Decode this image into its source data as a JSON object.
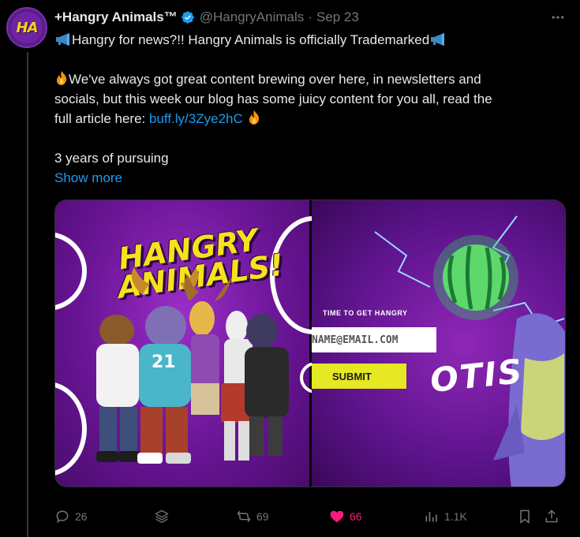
{
  "tweet": {
    "display_name": "+Hangry Animals™",
    "handle": "@HangryAnimals",
    "separator": "·",
    "date": "Sep 23",
    "avatar_text": "HA",
    "lines": {
      "line1": "Hangry for news?!! Hangry Animals is officially Trademarked",
      "line2": "We've always got great content brewing over here, in newsletters and",
      "line3": "socials, but this week our blog has some juicy content for you all, read the",
      "line4_prefix": "full article here: ",
      "link": "buff.ly/3Zye2hC",
      "line5": "3 years of pursuing"
    },
    "show_more": "Show more"
  },
  "media": {
    "left": {
      "logo_line1": "HANGRY",
      "logo_line2": "ANIMALS!"
    },
    "right": {
      "form_label": "TIME TO GET HANGRY",
      "input_value": "NAME@EMAIL.COM",
      "submit_label": "SUBMIT",
      "character_name": "OTIS"
    }
  },
  "actions": {
    "replies": "26",
    "retweets": "69",
    "likes": "66",
    "views": "1.1K"
  },
  "colors": {
    "background": "#000000",
    "text": "#e7e9ea",
    "muted": "#71767b",
    "link": "#1d9bf0",
    "like": "#f91880",
    "verified": "#1d9bf0",
    "brand_purple": "#6a1596",
    "brand_yellow": "#f6e21c"
  },
  "icons": {
    "more": "more-horizontal-icon",
    "verified": "verified-badge-icon",
    "reply": "reply-icon",
    "grok": "grok-icon",
    "retweet": "retweet-icon",
    "like": "heart-filled-icon",
    "views": "views-icon",
    "bookmark": "bookmark-icon",
    "share": "share-icon"
  }
}
